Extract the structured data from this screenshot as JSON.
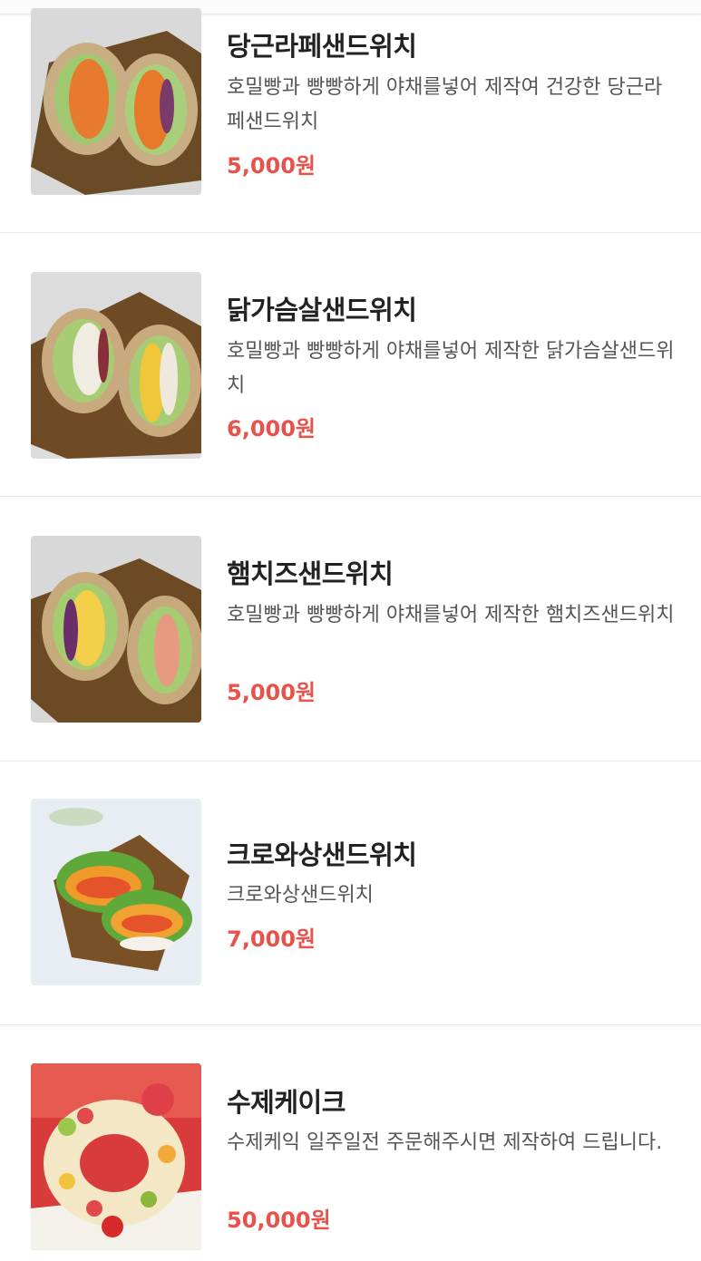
{
  "colors": {
    "price": "#e8524b",
    "name": "#222222",
    "desc": "#555555",
    "divider": "#e9e9e9"
  },
  "menu": {
    "items": [
      {
        "name": "당근라페샌드위치",
        "desc": "호밀빵과 빵빵하게 야채를넣어 제작여 건강한 당근라페샌드위치",
        "price": "5,000원",
        "image": "carrot-rapee-sandwich-photo"
      },
      {
        "name": "닭가슴살샌드위치",
        "desc": "호밀빵과 빵빵하게 야채를넣어 제작한 닭가슴살샌드위치",
        "price": "6,000원",
        "image": "chicken-breast-sandwich-photo"
      },
      {
        "name": "햄치즈샌드위치",
        "desc": "호밀빵과 빵빵하게 야채를넣어 제작한 햄치즈샌드위치",
        "price": "5,000원",
        "image": "ham-cheese-sandwich-photo"
      },
      {
        "name": "크로와상샌드위치",
        "desc": "크로와상샌드위치",
        "price": "7,000원",
        "image": "croissant-sandwich-photo"
      },
      {
        "name": "수제케이크",
        "desc": "수제케익 일주일전 주문해주시면 제작하여 드립니다.",
        "price": "50,000원",
        "image": "handmade-cake-photo"
      }
    ]
  }
}
